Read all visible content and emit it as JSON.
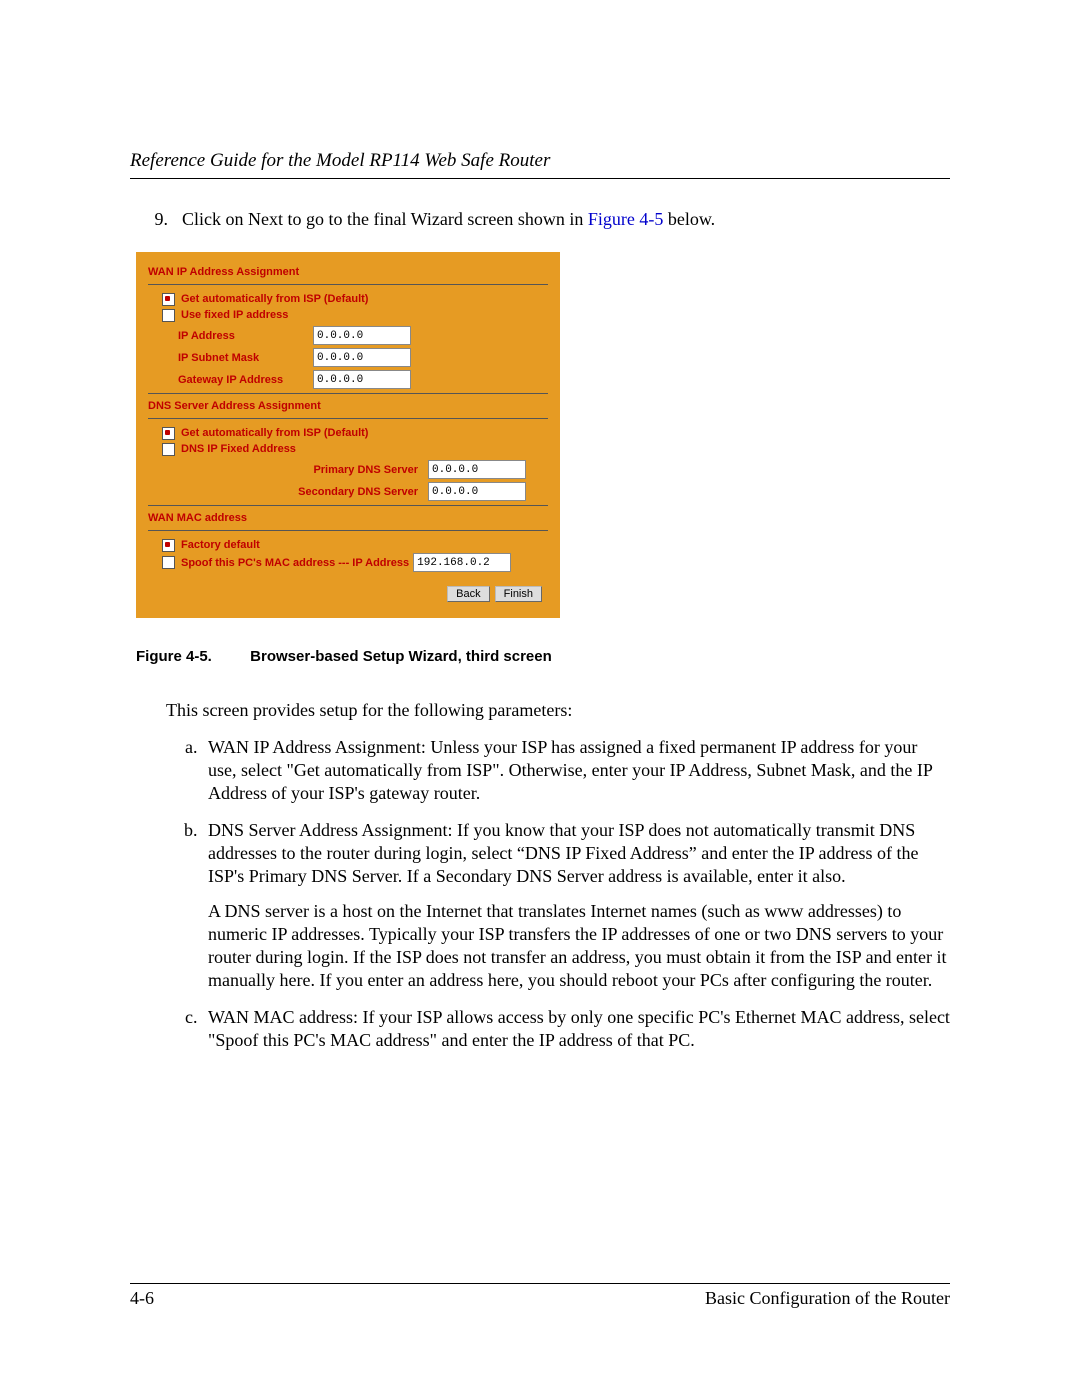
{
  "header": {
    "title": "Reference Guide for the Model RP114 Web Safe Router"
  },
  "step": {
    "number": "9.",
    "text_before": "Click on Next to go to the final Wizard screen shown in ",
    "figref": "Figure 4-5",
    "text_after": " below."
  },
  "wizard": {
    "wan_ip": {
      "title": "WAN IP Address Assignment",
      "auto": "Get automatically from ISP (Default)",
      "fixed": "Use fixed IP address",
      "ip_label": "IP Address",
      "ip_value": "0.0.0.0",
      "mask_label": "IP Subnet Mask",
      "mask_value": "0.0.0.0",
      "gw_label": "Gateway IP Address",
      "gw_value": "0.0.0.0"
    },
    "dns": {
      "title": "DNS Server Address Assignment",
      "auto": "Get automatically from ISP (Default)",
      "fixed": "DNS IP Fixed Address",
      "primary_label": "Primary DNS Server",
      "primary_value": "0.0.0.0",
      "secondary_label": "Secondary DNS Server",
      "secondary_value": "0.0.0.0"
    },
    "mac": {
      "title": "WAN MAC address",
      "factory": "Factory default",
      "spoof": "Spoof this PC's MAC address --- IP Address",
      "spoof_value": "192.168.0.2"
    },
    "buttons": {
      "back": "Back",
      "finish": "Finish"
    }
  },
  "figcaption": {
    "num": "Figure 4-5.",
    "text": "Browser-based Setup Wizard, third screen"
  },
  "intro": "This screen provides setup for the following parameters:",
  "items": {
    "a": "WAN IP Address Assignment: Unless your ISP has assigned a fixed permanent IP address for your use, select \"Get automatically from ISP\". Otherwise, enter your IP Address, Subnet Mask, and the IP Address of your ISP's gateway router.",
    "b1": "DNS Server Address Assignment: If you know that your ISP does not automatically transmit DNS addresses to the router during login, select “DNS IP Fixed Address” and enter the IP address of the ISP's Primary DNS Server. If a Secondary DNS Server address is available, enter it also.",
    "b2": "A DNS server is a host on the Internet that translates Internet names (such as www addresses) to numeric IP addresses. Typically your ISP transfers the IP addresses of one or two DNS servers to your router during login. If the ISP does not transfer an address, you must obtain it from the ISP and enter it manually here. If you enter an address here, you should reboot your PCs after configuring the router.",
    "c": "WAN MAC address: If your ISP allows access by only one specific PC's Ethernet MAC address, select \"Spoof this PC's MAC address\" and enter the IP address of that PC."
  },
  "footer": {
    "left": "4-6",
    "right": "Basic Configuration of the Router"
  }
}
